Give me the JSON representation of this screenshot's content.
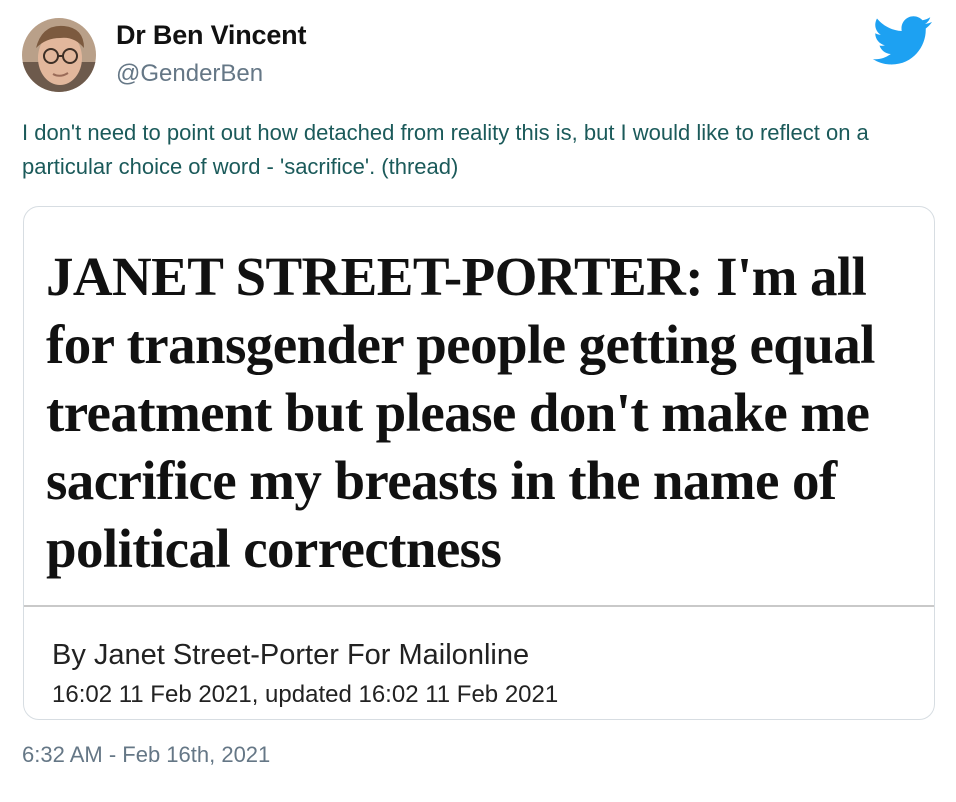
{
  "author": {
    "name": "Dr Ben Vincent",
    "handle": "@GenderBen"
  },
  "tweet": {
    "text": "I don't need to point out how detached from reality this is, but I would like to reflect on a particular choice of word - 'sacrifice'. (thread)",
    "timestamp": "6:32 AM - Feb 16th, 2021"
  },
  "card": {
    "headline": "JANET STREET-PORTER: I'm all for transgender people getting equal treatment but please don't make me sacrifice my breasts in the name of political correctness",
    "byline": "By Janet Street-Porter For Mailonline",
    "dateline": "16:02 11 Feb 2021, updated 16:02 11 Feb 2021"
  },
  "icons": {
    "brand": "twitter-bird-icon",
    "brand_color": "#1DA1F2"
  },
  "colors": {
    "tweet_text": "#1b5a5a",
    "muted": "#657786"
  }
}
